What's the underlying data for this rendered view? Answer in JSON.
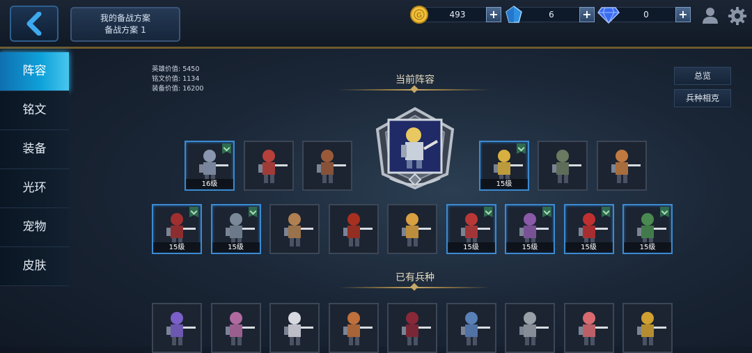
{
  "header": {
    "plan_title": "我的备战方案",
    "plan_name": "备战方案 1",
    "currencies": [
      {
        "icon": "gold-coin-icon",
        "value": "493"
      },
      {
        "icon": "blue-crystal-icon",
        "value": "6"
      },
      {
        "icon": "diamond-icon",
        "value": "0"
      }
    ],
    "icons": [
      "profile-icon",
      "settings-gear-icon"
    ]
  },
  "sidebar": {
    "items": [
      {
        "label": "阵容",
        "active": true
      },
      {
        "label": "铭文",
        "active": false
      },
      {
        "label": "装备",
        "active": false
      },
      {
        "label": "光环",
        "active": false
      },
      {
        "label": "宠物",
        "active": false
      },
      {
        "label": "皮肤",
        "active": false
      }
    ]
  },
  "stats": {
    "hero_value": "英雄价值: 5450",
    "rune_value": "铭文价值: 1134",
    "equip_value": "装备价值: 16200"
  },
  "buttons": {
    "overview": "总览",
    "counters": "兵种相克"
  },
  "sections": {
    "current_lineup": "当前阵容",
    "owned_units": "已有兵种"
  },
  "lineup_row1": [
    {
      "level": "16级",
      "ranked": true,
      "border": "blue",
      "color": "#8a96b0"
    },
    {
      "level": "",
      "ranked": false,
      "border": "grey",
      "color": "#b8403a"
    },
    {
      "level": "",
      "ranked": false,
      "border": "grey",
      "color": "#9a5a3a"
    },
    {
      "level": "15级",
      "ranked": true,
      "border": "blue",
      "color": "#d8b040"
    },
    {
      "level": "",
      "ranked": false,
      "border": "grey",
      "color": "#6a7a60"
    },
    {
      "level": "",
      "ranked": false,
      "border": "grey",
      "color": "#c07a40"
    }
  ],
  "lineup_row2": [
    {
      "level": "15级",
      "ranked": true,
      "border": "blue",
      "color": "#a03030"
    },
    {
      "level": "15级",
      "ranked": true,
      "border": "blue",
      "color": "#7a8898"
    },
    {
      "level": "",
      "ranked": false,
      "border": "grey",
      "color": "#b08050"
    },
    {
      "level": "",
      "ranked": false,
      "border": "grey",
      "color": "#a83020"
    },
    {
      "level": "",
      "ranked": false,
      "border": "grey",
      "color": "#d8a040"
    },
    {
      "level": "15级",
      "ranked": true,
      "border": "blue",
      "color": "#b83838"
    },
    {
      "level": "15级",
      "ranked": true,
      "border": "blue",
      "color": "#8a5aa8"
    },
    {
      "level": "15级",
      "ranked": true,
      "border": "blue",
      "color": "#c03030"
    },
    {
      "level": "15级",
      "ranked": true,
      "border": "blue",
      "color": "#4a8a50"
    }
  ],
  "owned_units": [
    {
      "color": "#7a60c8"
    },
    {
      "color": "#b06aa0"
    },
    {
      "color": "#d8d8e0"
    },
    {
      "color": "#c0703a"
    },
    {
      "color": "#8a2838"
    },
    {
      "color": "#5a80b8"
    },
    {
      "color": "#9aa0a8"
    },
    {
      "color": "#d86a70"
    },
    {
      "color": "#d0a030"
    }
  ],
  "colors": {
    "accent_active": "#0fa2da",
    "card_border_blue": "#3c8ad2",
    "gold_line": "#c7a865"
  }
}
